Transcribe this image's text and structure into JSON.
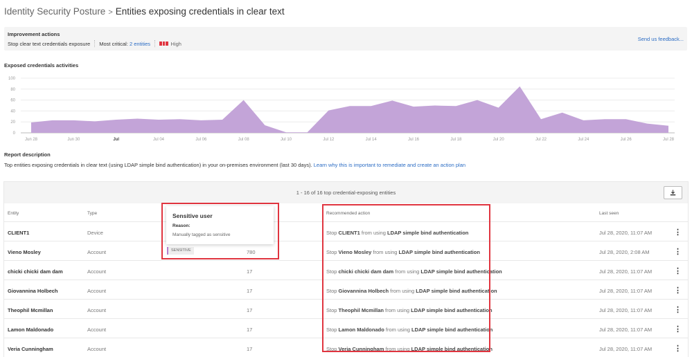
{
  "header": {
    "breadcrumb_root": "Identity Security Posture",
    "breadcrumb_sep": ">",
    "title": "Entities exposing credentials in clear text"
  },
  "improvement": {
    "label": "Improvement actions",
    "action": "Stop clear text credentials exposure",
    "most_critical_label": "Most critical:",
    "most_critical_link": "2 entities",
    "severity": "High",
    "severity_color": "#e0343f",
    "feedback": "Send us feedback..."
  },
  "chart_section": {
    "title": "Exposed credentials activities"
  },
  "chart_data": {
    "type": "area",
    "title": "Exposed credentials activities",
    "xlabel": "",
    "ylabel": "",
    "ylim": [
      0,
      100
    ],
    "yticks": [
      0,
      20,
      40,
      60,
      80,
      100
    ],
    "grid": true,
    "color": "#c3a4d8",
    "x": [
      "Jun 28",
      "Jun 29",
      "Jun 30",
      "Jul 01",
      "Jul 02",
      "Jul 03",
      "Jul 04",
      "Jul 05",
      "Jul 06",
      "Jul 07",
      "Jul 08",
      "Jul 09",
      "Jul 10",
      "Jul 11",
      "Jul 12",
      "Jul 13",
      "Jul 14",
      "Jul 15",
      "Jul 16",
      "Jul 17",
      "Jul 18",
      "Jul 19",
      "Jul 20",
      "Jul 21",
      "Jul 22",
      "Jul 23",
      "Jul 24",
      "Jul 25",
      "Jul 26",
      "Jul 27",
      "Jul 28"
    ],
    "values": [
      19,
      23,
      23,
      21,
      24,
      26,
      24,
      25,
      23,
      24,
      60,
      14,
      1,
      1,
      41,
      49,
      49,
      59,
      48,
      50,
      49,
      60,
      46,
      85,
      25,
      37,
      23,
      25,
      25,
      17,
      13
    ],
    "xtick_labels": [
      {
        "index": 0,
        "label": "Jun 28",
        "bold": false
      },
      {
        "index": 2,
        "label": "Jun 30",
        "bold": false
      },
      {
        "index": 4,
        "label": "Jul",
        "bold": true
      },
      {
        "index": 6,
        "label": "Jul 04",
        "bold": false
      },
      {
        "index": 8,
        "label": "Jul 06",
        "bold": false
      },
      {
        "index": 10,
        "label": "Jul 08",
        "bold": false
      },
      {
        "index": 12,
        "label": "Jul 10",
        "bold": false
      },
      {
        "index": 14,
        "label": "Jul 12",
        "bold": false
      },
      {
        "index": 16,
        "label": "Jul 14",
        "bold": false
      },
      {
        "index": 18,
        "label": "Jul 16",
        "bold": false
      },
      {
        "index": 20,
        "label": "Jul 18",
        "bold": false
      },
      {
        "index": 22,
        "label": "Jul 20",
        "bold": false
      },
      {
        "index": 24,
        "label": "Jul 22",
        "bold": false
      },
      {
        "index": 26,
        "label": "Jul 24",
        "bold": false
      },
      {
        "index": 28,
        "label": "Jul 26",
        "bold": false
      },
      {
        "index": 30,
        "label": "Jul 28",
        "bold": false
      }
    ]
  },
  "report": {
    "title": "Report description",
    "description": "Top entities exposing credentials in clear text (using LDAP simple bind authentication) in your on-premises environment (last 30 days).",
    "link": "Learn why this is important to remediate and create an action plan"
  },
  "table": {
    "count_text": "1 - 16 of 16 top credential-exposing entities",
    "download_icon": "download-icon",
    "columns": {
      "entity": "Entity",
      "type": "Type",
      "recommended_action": "Recommended action",
      "last_seen": "Last seen"
    },
    "action_prefix": "Stop",
    "action_middle": "from using",
    "action_suffix": "LDAP simple bind authentication",
    "rows": [
      {
        "entity": "CLIENT1",
        "type": "Device",
        "tag": "",
        "count": "",
        "last_seen": "Jul 28, 2020, 11:07 AM"
      },
      {
        "entity": "Vieno Mosley",
        "type": "Account",
        "tag": "SENSITIVE",
        "count": "780",
        "last_seen": "Jul 28, 2020, 2:08 AM"
      },
      {
        "entity": "chicki chicki dam dam",
        "type": "Account",
        "tag": "",
        "count": "17",
        "last_seen": "Jul 28, 2020, 11:07 AM"
      },
      {
        "entity": "Giovannina Holbech",
        "type": "Account",
        "tag": "",
        "count": "17",
        "last_seen": "Jul 28, 2020, 11:07 AM"
      },
      {
        "entity": "Theophil Mcmillan",
        "type": "Account",
        "tag": "",
        "count": "17",
        "last_seen": "Jul 28, 2020, 11:07 AM"
      },
      {
        "entity": "Lamon Maldonado",
        "type": "Account",
        "tag": "",
        "count": "17",
        "last_seen": "Jul 28, 2020, 11:07 AM"
      },
      {
        "entity": "Veria Cunningham",
        "type": "Account",
        "tag": "",
        "count": "17",
        "last_seen": "Jul 28, 2020, 11:07 AM"
      }
    ],
    "more_icon": "more-vertical-icon"
  },
  "tooltip": {
    "title": "Sensitive user",
    "reason_label": "Reason:",
    "reason": "Manually tagged as sensitive"
  },
  "highlight_color": "#e0343f"
}
